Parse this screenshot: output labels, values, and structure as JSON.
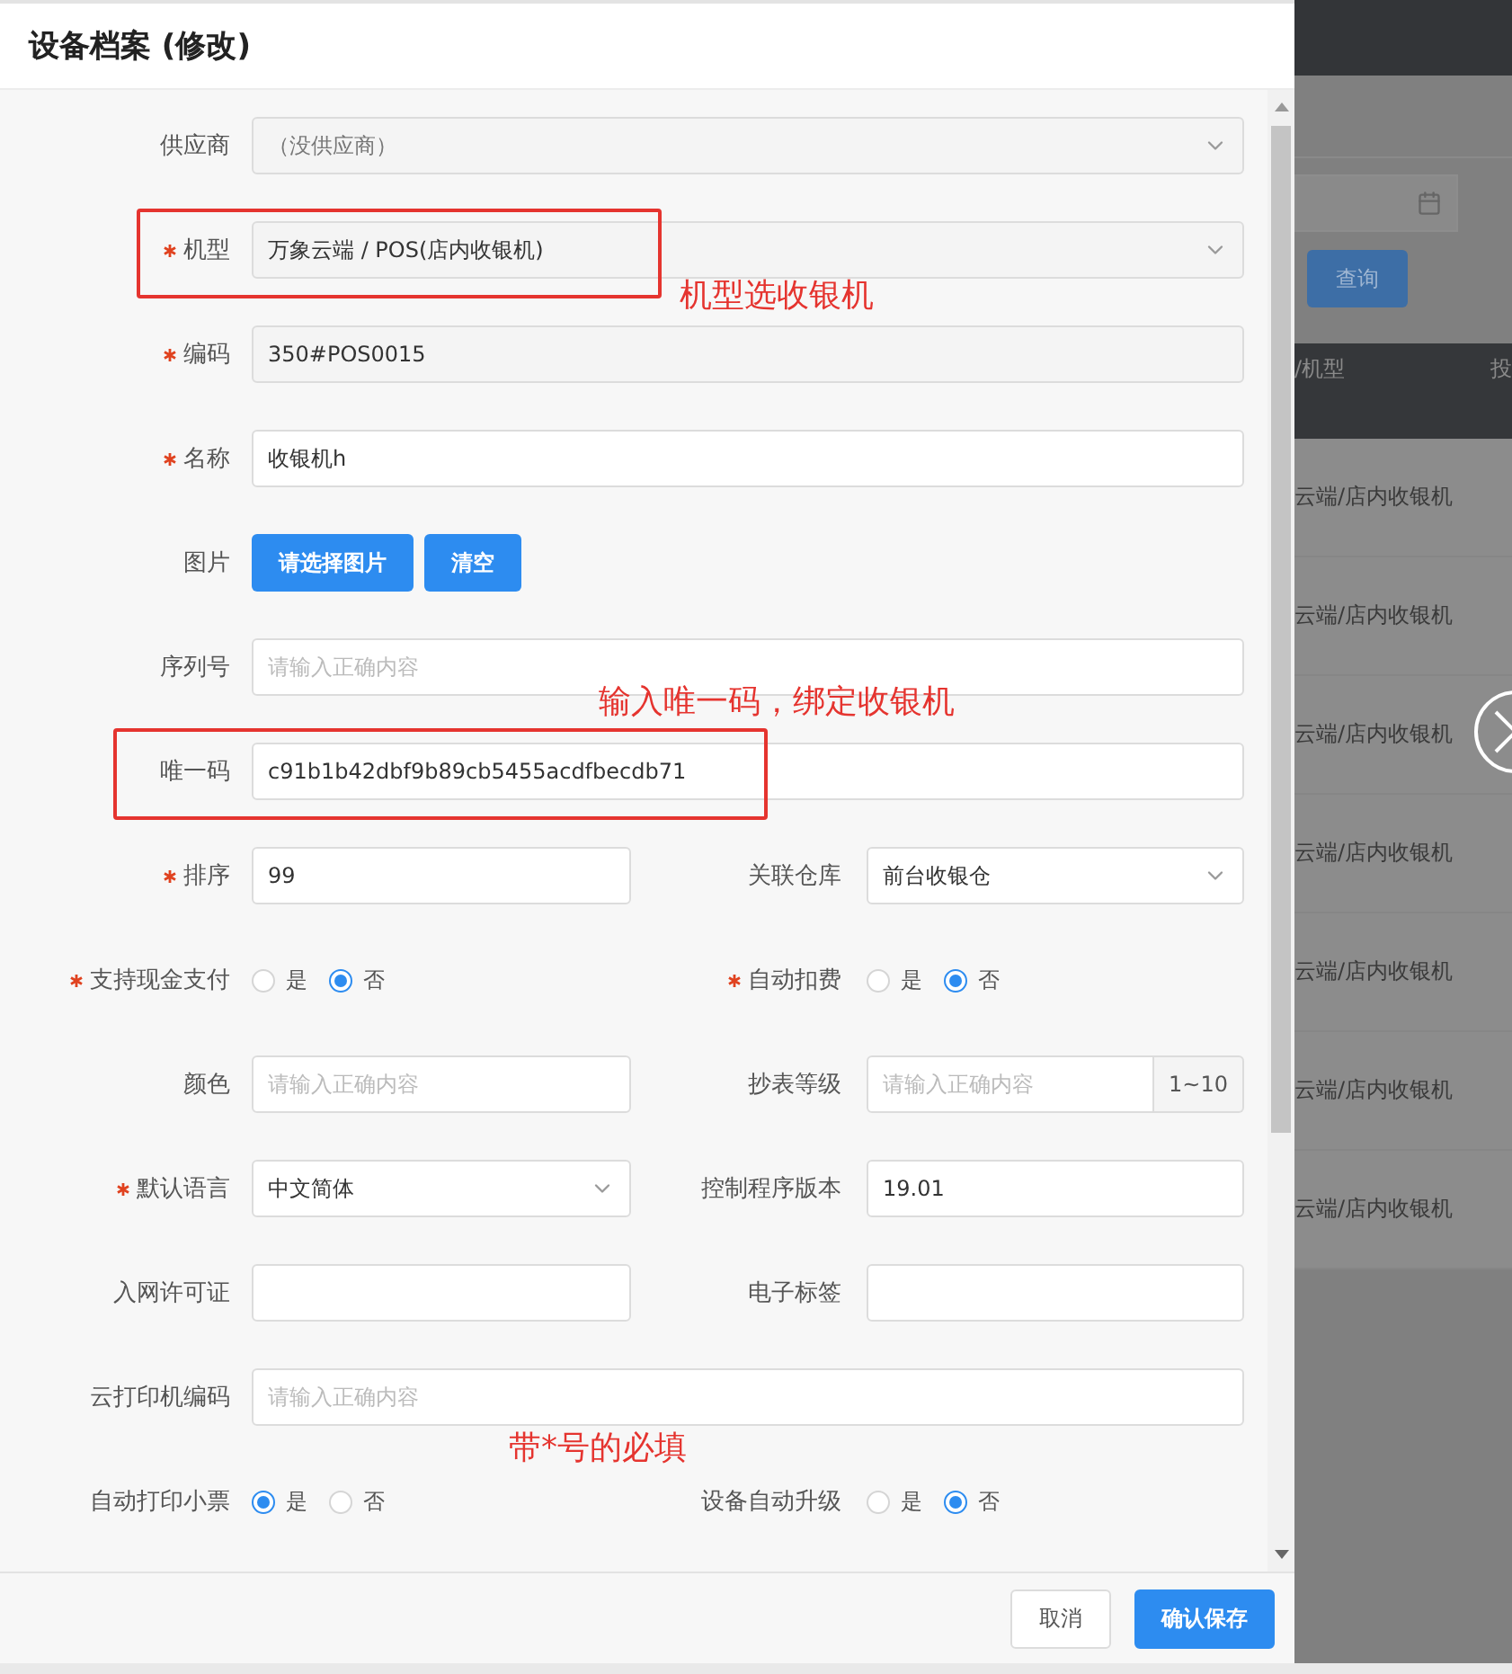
{
  "dialog": {
    "title": "设备档案 (修改)",
    "rows": [
      {
        "fields": [
          {
            "label": "供应商",
            "kind": "select",
            "value": "（没供应商）",
            "disabled": true
          }
        ]
      },
      {
        "fields": [
          {
            "label": "机型",
            "required": true,
            "kind": "select",
            "value": "万象云端 / POS(店内收银机)",
            "readonly": true
          }
        ]
      },
      {
        "fields": [
          {
            "label": "编码",
            "required": true,
            "kind": "input",
            "value": "350#POS0015",
            "readonly": true
          }
        ]
      },
      {
        "fields": [
          {
            "label": "名称",
            "required": true,
            "kind": "input",
            "value": "收银机h"
          }
        ]
      },
      {
        "fields": [
          {
            "label": "图片",
            "kind": "buttons",
            "buttons": [
              "请选择图片",
              "清空"
            ]
          }
        ]
      },
      {
        "fields": [
          {
            "label": "序列号",
            "kind": "input",
            "placeholder": "请输入正确内容"
          }
        ]
      },
      {
        "fields": [
          {
            "label": "唯一码",
            "kind": "input",
            "value": "c91b1b42dbf9b89cb5455acdfbecdb71"
          }
        ]
      },
      {
        "fields": [
          {
            "label": "排序",
            "required": true,
            "kind": "input",
            "value": "99"
          },
          {
            "label": "关联仓库",
            "kind": "select",
            "value": "前台收银仓"
          }
        ]
      },
      {
        "fields": [
          {
            "label": "支持现金支付",
            "required": true,
            "kind": "radio",
            "options": [
              {
                "label": "是",
                "selected": false
              },
              {
                "label": "否",
                "selected": true
              }
            ]
          },
          {
            "label": "自动扣费",
            "required": true,
            "kind": "radio",
            "options": [
              {
                "label": "是",
                "selected": false
              },
              {
                "label": "否",
                "selected": true
              }
            ]
          }
        ]
      },
      {
        "fields": [
          {
            "label": "颜色",
            "kind": "input",
            "placeholder": "请输入正确内容"
          },
          {
            "label": "抄表等级",
            "kind": "addon",
            "placeholder": "请输入正确内容",
            "addon": "1~10"
          }
        ]
      },
      {
        "fields": [
          {
            "label": "默认语言",
            "required": true,
            "kind": "select",
            "value": "中文简体"
          },
          {
            "label": "控制程序版本",
            "kind": "input",
            "value": "19.01"
          }
        ]
      },
      {
        "fields": [
          {
            "label": "入网许可证",
            "kind": "input"
          },
          {
            "label": "电子标签",
            "kind": "input"
          }
        ]
      },
      {
        "fields": [
          {
            "label": "云打印机编码",
            "kind": "input",
            "placeholder": "请输入正确内容"
          }
        ]
      },
      {
        "fields": [
          {
            "label": "自动打印小票",
            "kind": "radio",
            "options": [
              {
                "label": "是",
                "selected": true
              },
              {
                "label": "否",
                "selected": false
              }
            ]
          },
          {
            "label": "设备自动升级",
            "kind": "radio",
            "options": [
              {
                "label": "是",
                "selected": false
              },
              {
                "label": "否",
                "selected": true
              }
            ]
          }
        ]
      }
    ],
    "footer_buttons": [
      {
        "label": "取消",
        "kind": "default"
      },
      {
        "label": "确认保存",
        "kind": "primary"
      }
    ]
  },
  "background_page": {
    "query_button": "查询",
    "table": {
      "columns": [
        "/机型",
        "投"
      ],
      "rows": [
        [
          "云端/店内收银机"
        ],
        [
          "云端/店内收银机"
        ],
        [
          "云端/店内收银机"
        ],
        [
          "云端/店内收银机"
        ],
        [
          "云端/店内收银机"
        ],
        [
          "云端/店内收银机"
        ],
        [
          "云端/店内收银机"
        ]
      ]
    }
  },
  "annotations": [
    {
      "kind": "box"
    },
    {
      "kind": "note",
      "text": "机型选收银机"
    },
    {
      "kind": "note",
      "text": "输入唯一码，绑定收银机"
    },
    {
      "kind": "box"
    },
    {
      "kind": "note",
      "text": "带*号的必填"
    }
  ]
}
